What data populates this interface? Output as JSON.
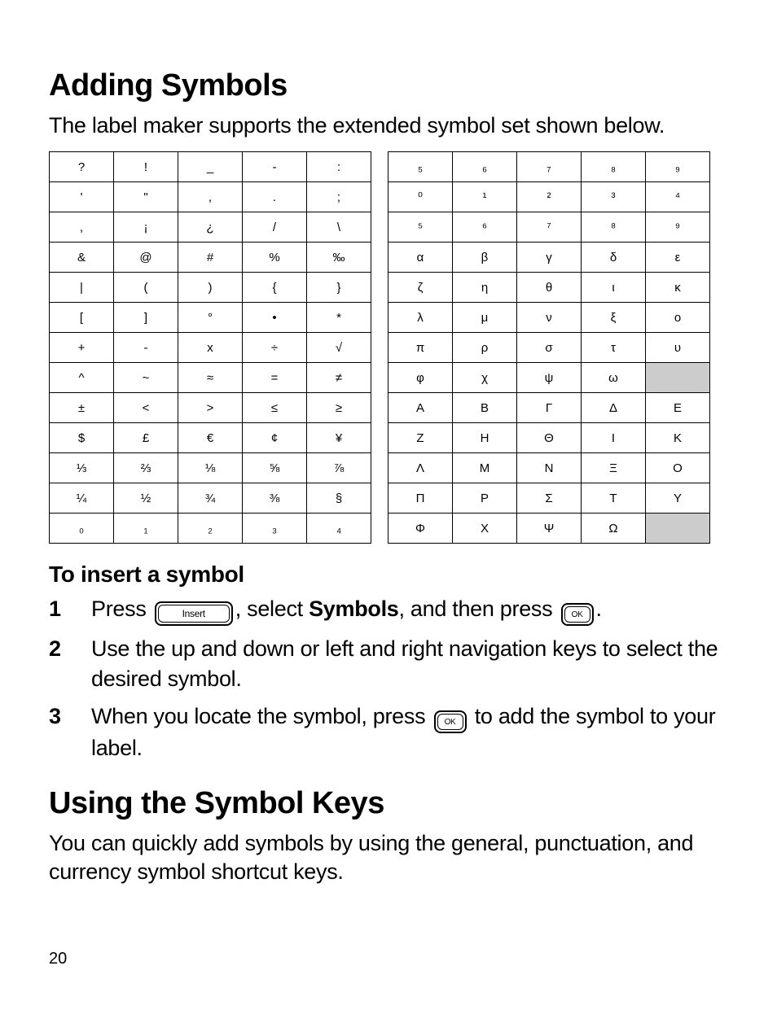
{
  "page_number": "20",
  "heading1": "Adding Symbols",
  "intro1": "The label maker supports the extended symbol set shown below.",
  "subhead": "To insert a symbol",
  "step1_a": "Press ",
  "step1_b": ", select ",
  "step1_symbols": "Symbols",
  "step1_c": ", and then press ",
  "step1_d": ".",
  "step2": "Use the up and down or left and right navigation keys to select the desired symbol.",
  "step3_a": "When you locate the symbol, press ",
  "step3_b": " to add the symbol to your label.",
  "heading2": "Using the Symbol Keys",
  "intro2": "You can quickly add symbols by using the general, punctuation, and currency symbol shortcut keys.",
  "key_insert_label": "Insert",
  "key_ok_label": "OK",
  "table_left": [
    [
      "?",
      "!",
      "_",
      "-",
      ":"
    ],
    [
      "'",
      "\"",
      ",",
      ".",
      ";"
    ],
    [
      ",",
      "¡",
      "¿",
      "/",
      "\\"
    ],
    [
      "&",
      "@",
      "#",
      "%",
      "‰"
    ],
    [
      "|",
      "(",
      ")",
      "{",
      "}"
    ],
    [
      "[",
      "]",
      "°",
      "•",
      "*"
    ],
    [
      "+",
      "-",
      "x",
      "÷",
      "√"
    ],
    [
      "^",
      "~",
      "≈",
      "=",
      "≠"
    ],
    [
      "±",
      "<",
      ">",
      "≤",
      "≥"
    ],
    [
      "$",
      "£",
      "€",
      "¢",
      "¥"
    ],
    [
      "⅓",
      "⅔",
      "⅛",
      "⅝",
      "⅞"
    ],
    [
      "¼",
      "½",
      "¾",
      "⅜",
      "§"
    ],
    [
      "₀",
      "₁",
      "₂",
      "₃",
      "₄"
    ]
  ],
  "table_right": [
    [
      "₅",
      "₆",
      "₇",
      "₈",
      "₉"
    ],
    [
      "⁰",
      "¹",
      "²",
      "³",
      "⁴"
    ],
    [
      "⁵",
      "⁶",
      "⁷",
      "⁸",
      "⁹"
    ],
    [
      "α",
      "β",
      "γ",
      "δ",
      "ε"
    ],
    [
      "ζ",
      "η",
      "θ",
      "ι",
      "κ"
    ],
    [
      "λ",
      "μ",
      "ν",
      "ξ",
      "ο"
    ],
    [
      "π",
      "ρ",
      "σ",
      "τ",
      "υ"
    ],
    [
      "φ",
      "χ",
      "ψ",
      "ω",
      ""
    ],
    [
      "Α",
      "Β",
      "Γ",
      "Δ",
      "Ε"
    ],
    [
      "Ζ",
      "Η",
      "Θ",
      "Ι",
      "Κ"
    ],
    [
      "Λ",
      "Μ",
      "Ν",
      "Ξ",
      "Ο"
    ],
    [
      "Π",
      "Ρ",
      "Σ",
      "Τ",
      "Υ"
    ],
    [
      "Φ",
      "Χ",
      "Ψ",
      "Ω",
      ""
    ]
  ],
  "table_right_shaded": [
    [
      7,
      4
    ],
    [
      12,
      4
    ]
  ]
}
